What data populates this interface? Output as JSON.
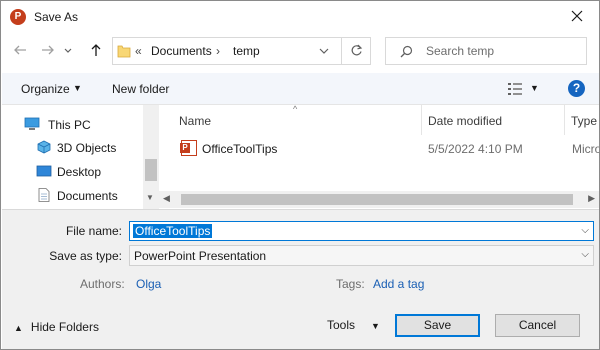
{
  "window": {
    "title": "Save As",
    "app_icon_letter": "P",
    "accent_color": "#0078d7",
    "app_color": "#c43e1c"
  },
  "address": {
    "overflow_indicator": "«",
    "crumbs": [
      "Documents",
      "temp"
    ],
    "crumb_separator": "›"
  },
  "search": {
    "placeholder": "Search temp"
  },
  "toolbar": {
    "organize_label": "Organize",
    "new_folder_label": "New folder",
    "help_label": "?"
  },
  "nav_pane": {
    "items": [
      {
        "label": "This PC",
        "icon": "this-pc-icon"
      },
      {
        "label": "3D Objects",
        "icon": "3d-objects-icon"
      },
      {
        "label": "Desktop",
        "icon": "desktop-icon"
      },
      {
        "label": "Documents",
        "icon": "documents-icon"
      }
    ]
  },
  "file_list": {
    "columns": [
      "Name",
      "Date modified",
      "Type"
    ],
    "rows": [
      {
        "name": "OfficeToolTips",
        "date_modified": "5/5/2022 4:10 PM",
        "type": "Micro",
        "icon": "powerpoint-file-icon"
      }
    ]
  },
  "form": {
    "file_name_label": "File name:",
    "file_name_value": "OfficeToolTips",
    "save_as_type_label": "Save as type:",
    "save_as_type_value": "PowerPoint Presentation",
    "authors_label": "Authors:",
    "authors_value": "Olga",
    "tags_label": "Tags:",
    "tags_value": "Add a tag"
  },
  "footer": {
    "hide_folders_label": "Hide Folders",
    "tools_label": "Tools",
    "save_label": "Save",
    "cancel_label": "Cancel"
  }
}
